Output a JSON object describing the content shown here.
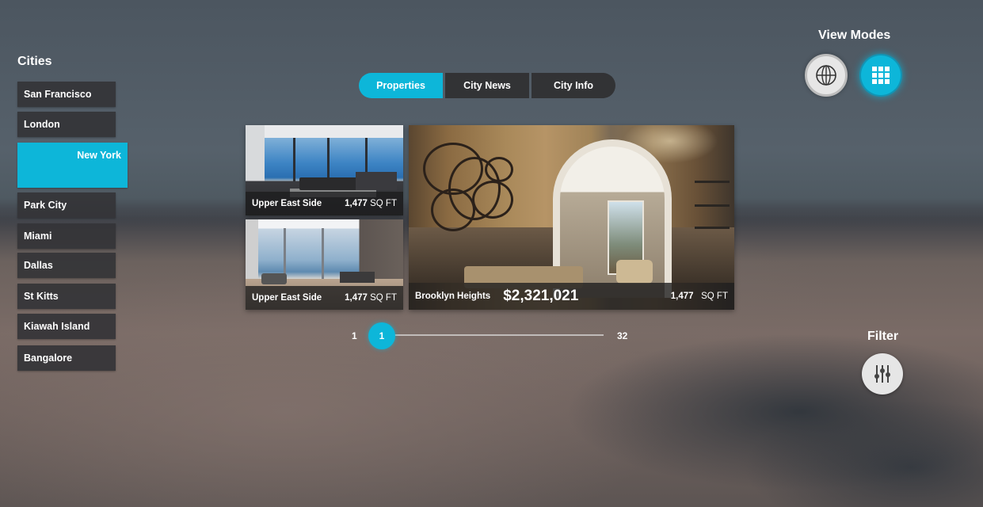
{
  "sidebar": {
    "title": "Cities",
    "items": [
      {
        "label": "San Francisco"
      },
      {
        "label": "London"
      },
      {
        "label": "New York",
        "selected": true
      },
      {
        "label": "Park City"
      },
      {
        "label": "Miami"
      },
      {
        "label": "Dallas"
      },
      {
        "label": "St Kitts"
      },
      {
        "label": "Kiawah Island"
      },
      {
        "label": "Bangalore"
      }
    ]
  },
  "tabs": [
    {
      "label": "Properties",
      "active": true
    },
    {
      "label": "City News",
      "active": false
    },
    {
      "label": "City Info",
      "active": false
    }
  ],
  "listings": [
    {
      "location": "Upper East Side",
      "sqft_value": "1,477",
      "sqft_unit": "SQ FT",
      "photo": "living-room-ocean-view"
    },
    {
      "location": "Upper East Side",
      "sqft_value": "1,477",
      "sqft_unit": "SQ FT",
      "photo": "bedroom-ocean-view"
    },
    {
      "location": "Brooklyn Heights",
      "price": "$2,321,021",
      "sqft_value": "1,477",
      "sqft_unit": "SQ FT",
      "photo": "entry-hall-arch"
    }
  ],
  "pager": {
    "start": "1",
    "current": "1",
    "end": "32",
    "progress": 0.0
  },
  "view_modes": {
    "title": "View Modes",
    "modes": [
      {
        "icon": "globe-icon",
        "active": false
      },
      {
        "icon": "grid-icon",
        "active": true
      }
    ]
  },
  "filter": {
    "title": "Filter",
    "icon": "sliders-icon"
  },
  "colors": {
    "accent": "#0db6d9",
    "tile": "#343437",
    "button_light": "#e6e6e6"
  }
}
